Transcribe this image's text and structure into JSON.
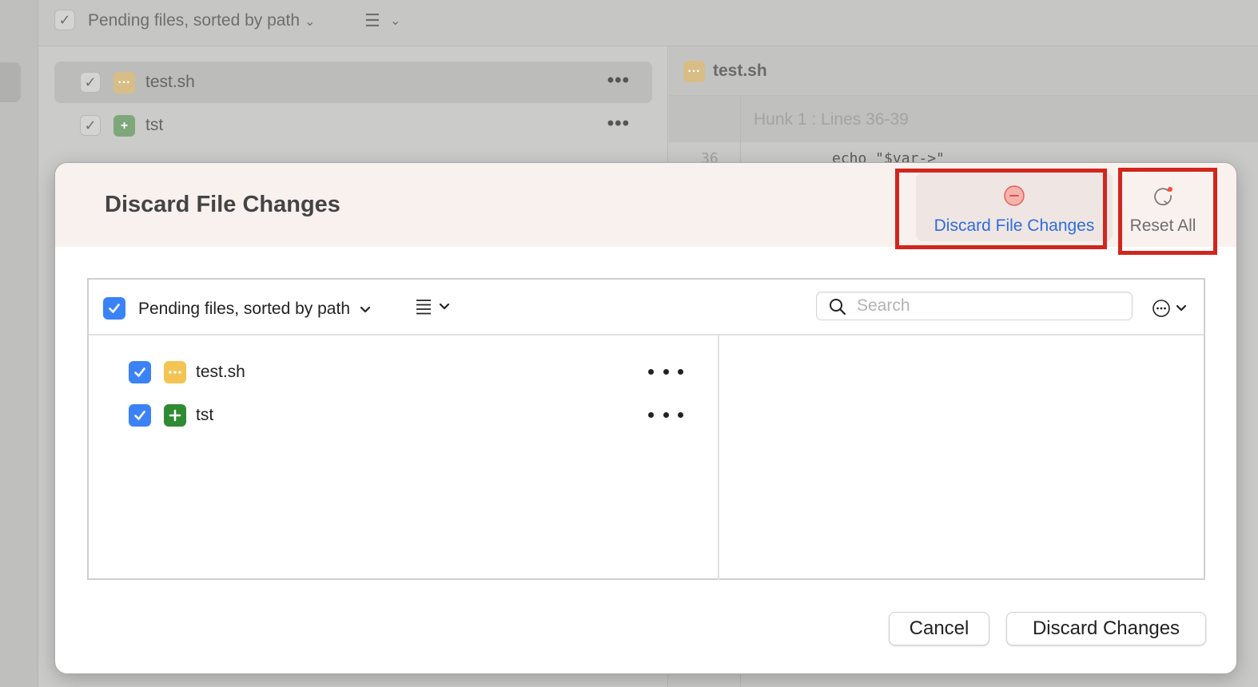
{
  "background": {
    "toolbar": {
      "sort_label": "Pending files, sorted by path"
    },
    "files": [
      {
        "name": "test.sh",
        "status": "modified",
        "selected": true
      },
      {
        "name": "tst",
        "status": "added",
        "selected": false
      }
    ],
    "diff": {
      "file_name": "test.sh",
      "hunk_label": "Hunk 1 : Lines 36-39",
      "line_number": "36",
      "code_line": "echo \"$var->\""
    }
  },
  "modal": {
    "title": "Discard File Changes",
    "toolbar": {
      "discard_label": "Discard File Changes",
      "reset_label": "Reset All"
    },
    "panel": {
      "sort_label": "Pending files, sorted by path",
      "search_placeholder": "Search",
      "search_value": "",
      "files": [
        {
          "name": "test.sh",
          "status": "modified",
          "checked": true
        },
        {
          "name": "tst",
          "status": "added",
          "checked": true
        }
      ]
    },
    "buttons": {
      "cancel": "Cancel",
      "discard": "Discard Changes"
    }
  },
  "colors": {
    "accent_blue": "#3b82f6",
    "link_blue": "#2f6ce0",
    "modified_yellow": "#f3c454",
    "added_green": "#2f8a34",
    "highlight_red": "#d1261e",
    "header_tint": "#f9f1ee"
  }
}
